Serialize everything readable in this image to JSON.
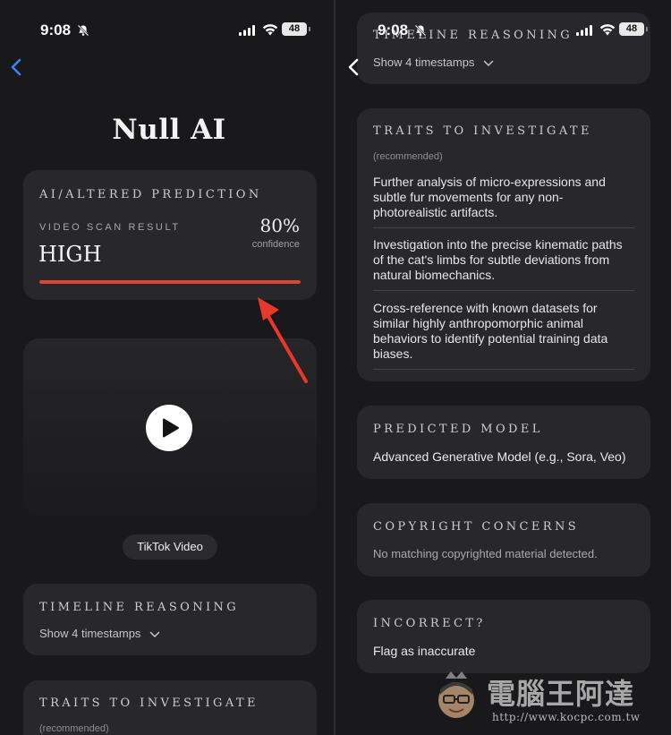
{
  "left": {
    "status": {
      "time": "9:08",
      "battery": "48"
    },
    "app_title": "Null AI",
    "prediction": {
      "caption": "AI/ALTERED PREDICTION",
      "scan_label": "VIDEO SCAN RESULT",
      "level": "HIGH",
      "percent": "80%",
      "confidence_label": "confidence",
      "bar_fraction": 1.0,
      "bar_color": "#d9443b"
    },
    "video": {
      "source_label": "TikTok Video"
    },
    "timeline": {
      "caption": "TIMELINE REASONING",
      "toggle": "Show 4 timestamps"
    },
    "traits": {
      "caption": "TRAITS TO INVESTIGATE",
      "note": "(recommended)"
    }
  },
  "right": {
    "status": {
      "time": "9:08",
      "battery": "48"
    },
    "timeline": {
      "caption": "TIMELINE REASONING",
      "toggle": "Show 4 timestamps"
    },
    "traits": {
      "caption": "TRAITS TO INVESTIGATE",
      "note": "(recommended)",
      "items": [
        "Further analysis of micro-expressions and subtle fur movements for any non-photorealistic artifacts.",
        "Investigation into the precise kinematic paths of the cat's limbs for subtle deviations from natural biomechanics.",
        "Cross-reference with known datasets for similar highly anthropomorphic animal behaviors to identify potential training data biases."
      ]
    },
    "model": {
      "caption": "PREDICTED MODEL",
      "value": "Advanced Generative Model (e.g., Sora, Veo)"
    },
    "copyright": {
      "caption": "COPYRIGHT CONCERNS",
      "value": "No matching copyrighted material detected."
    },
    "incorrect": {
      "caption": "INCORRECT?",
      "action": "Flag as inaccurate"
    }
  },
  "watermark": {
    "name": "電腦王阿達",
    "url": "http://www.kocpc.com.tw"
  },
  "colors": {
    "background": "#19191c",
    "card": "#28282c",
    "accent_back": "#3b82f6",
    "annotation_arrow": "#e8382b"
  }
}
